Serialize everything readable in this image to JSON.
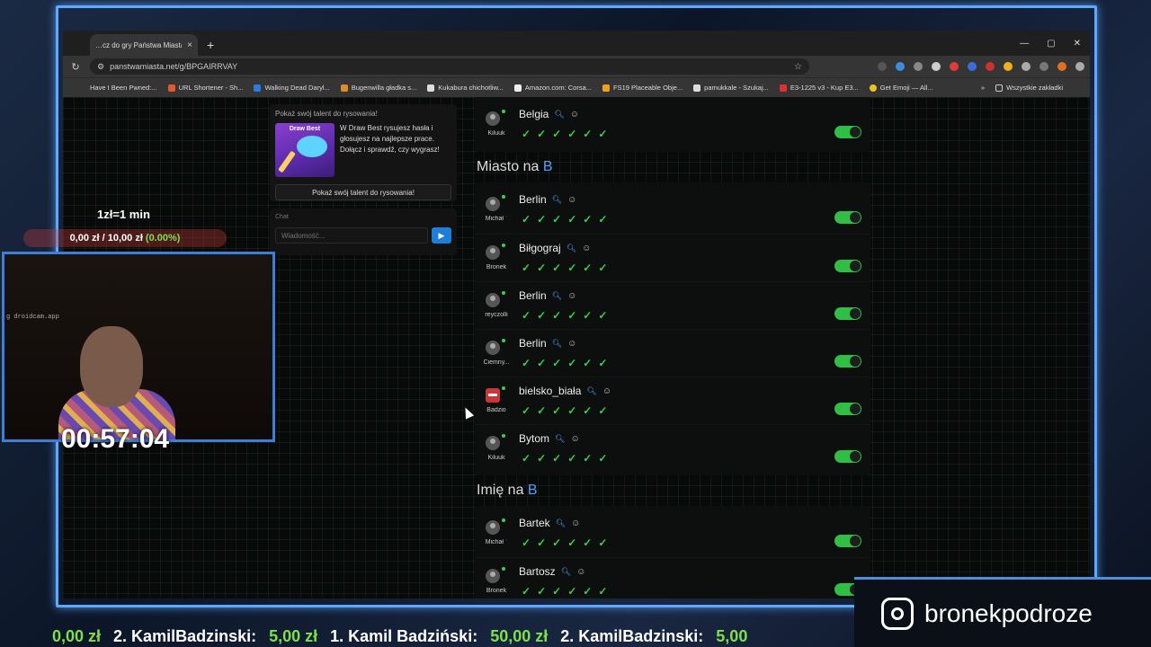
{
  "browser": {
    "tab_title": "…cz do gry Państwa Miasta",
    "url": "panstwamiasta.net/g/BPGAIRRVAY",
    "bookmarks": [
      "Have I Been Pwned:...",
      "URL Shortener - Sh...",
      "Walking Dead Daryl...",
      "Bugenwilla gładka s...",
      "Kukabura chichotliw...",
      "Amazon.com: Corsa...",
      "FS19 Placeable Obje...",
      "pamukkale - Szukaj...",
      "E3-1225 v3 - Kup E3...",
      "Get Emoji — All...",
      "Wszystkie zakładki"
    ]
  },
  "draw_card": {
    "title": "Pokaż swój talent do rysowania!",
    "image_label": "Draw Best",
    "text": "W Draw Best rysujesz hasła i głosujesz na najlepsze prace. Dołącz i sprawdź, czy wygrasz!",
    "button": "Pokaż swój talent do rysowania!"
  },
  "chat": {
    "title": "Chat",
    "placeholder": "Wiadomość..."
  },
  "top_row": {
    "answer": "Belgia",
    "user": "Kiluuk"
  },
  "categories": [
    {
      "label": "Miasto na",
      "letter": "B",
      "rows": [
        {
          "answer": "Berlin",
          "user": "Michał `"
        },
        {
          "answer": "Biłgograj",
          "user": "Bronek"
        },
        {
          "answer": "Berlin",
          "user": "reyczolli"
        },
        {
          "answer": "Berlin",
          "user": "Ciemny..."
        },
        {
          "answer": "bielsko_biała",
          "user": "Badzio"
        },
        {
          "answer": "Bytom",
          "user": "Kiluuk"
        }
      ]
    },
    {
      "label": "Imię na",
      "letter": "B",
      "rows": [
        {
          "answer": "Bartek",
          "user": "Michał `"
        },
        {
          "answer": "Bartosz",
          "user": "Bronek"
        }
      ]
    }
  ],
  "overlay": {
    "rate": "1zł=1 min",
    "money": "0,00 zł / 10,00 zł",
    "percent": "(0.00%)",
    "cam_watermark": "g droidcam.app",
    "timer": "00:57:04",
    "instagram": "bronekpodroze",
    "ticker": [
      {
        "amt": "0,00 zł",
        "text": "2. KamilBadzinski:"
      },
      {
        "amt": "5,00 zł",
        "text": "1. Kamil Badziński:"
      },
      {
        "amt": "50,00 zł",
        "text": "2. KamilBadzinski:"
      },
      {
        "amt": "5,00",
        "text": ""
      }
    ]
  }
}
